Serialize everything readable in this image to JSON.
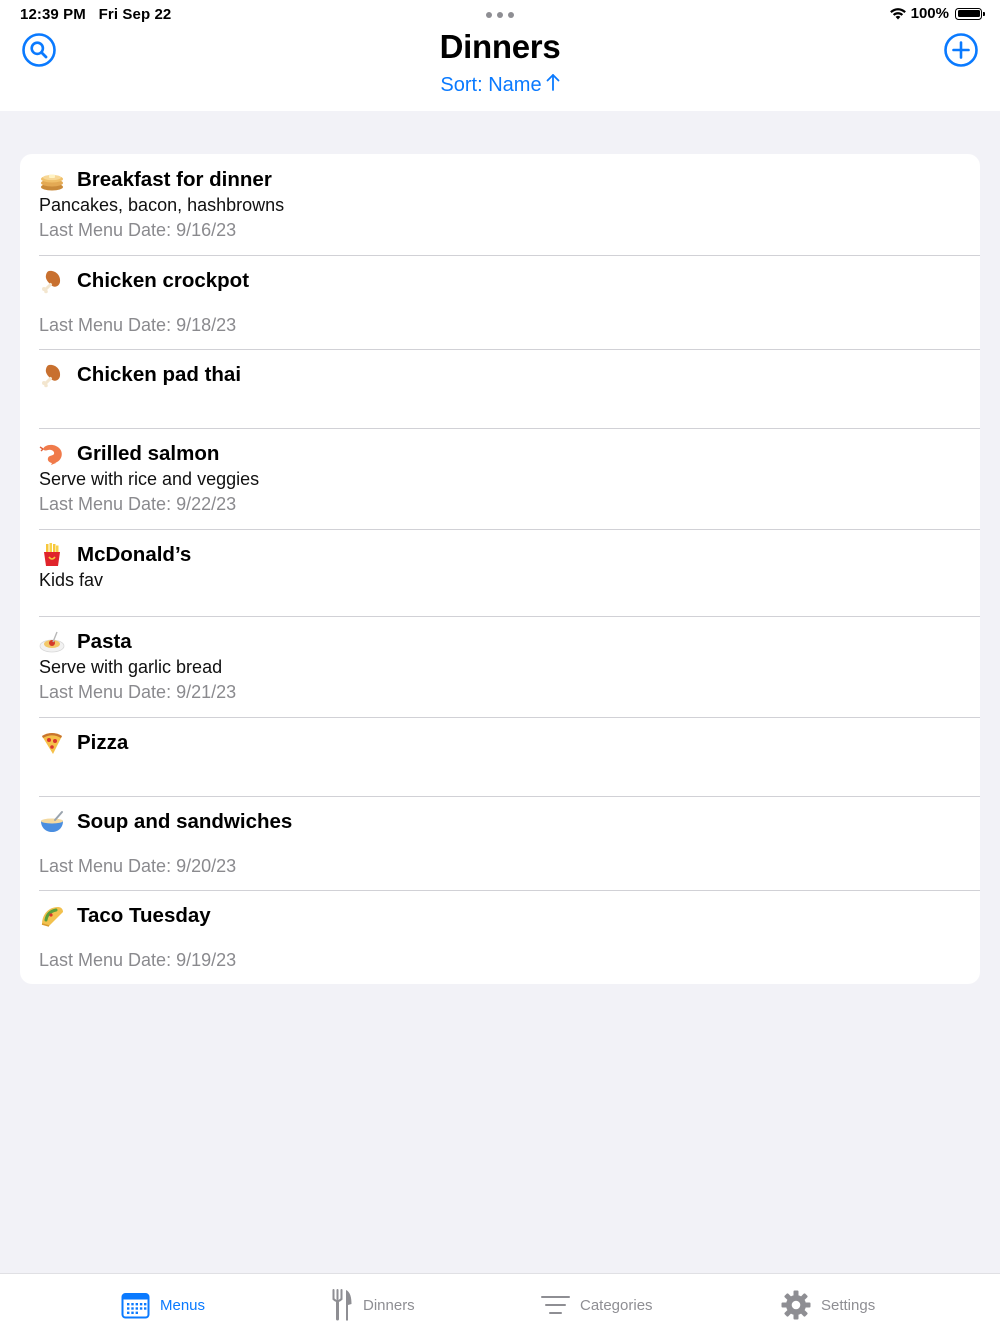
{
  "status_bar": {
    "time": "12:39 PM",
    "date": "Fri Sep 22",
    "battery": "100%"
  },
  "nav": {
    "title": "Dinners",
    "sort_label": "Sort: Name",
    "sort_direction_icon": "arrow-up-icon",
    "left_icon": "search-icon",
    "right_icon": "add-circle-icon"
  },
  "colors": {
    "accent": "#0a7aff",
    "background": "#f2f2f7",
    "secondary_text": "#8a8a8e"
  },
  "dinners": [
    {
      "emoji": "pancakes-icon",
      "name": "Breakfast for dinner",
      "description": "Pancakes, bacon, hashbrowns",
      "last_date": "Last Menu Date: 9/16/23"
    },
    {
      "emoji": "poultry-leg-icon",
      "name": "Chicken crockpot",
      "description": "",
      "last_date": "Last Menu Date: 9/18/23"
    },
    {
      "emoji": "poultry-leg-icon",
      "name": "Chicken pad thai",
      "description": "",
      "last_date": ""
    },
    {
      "emoji": "shrimp-icon",
      "name": "Grilled salmon",
      "description": "Serve with rice and veggies",
      "last_date": "Last Menu Date: 9/22/23"
    },
    {
      "emoji": "french-fries-icon",
      "name": "McDonald’s",
      "description": "Kids fav",
      "last_date": ""
    },
    {
      "emoji": "spaghetti-icon",
      "name": "Pasta",
      "description": "Serve with garlic bread",
      "last_date": "Last Menu Date: 9/21/23"
    },
    {
      "emoji": "pizza-icon",
      "name": "Pizza",
      "description": "",
      "last_date": ""
    },
    {
      "emoji": "soup-bowl-icon",
      "name": "Soup and sandwiches",
      "description": "",
      "last_date": "Last Menu Date: 9/20/23"
    },
    {
      "emoji": "taco-icon",
      "name": "Taco Tuesday",
      "description": "",
      "last_date": "Last Menu Date: 9/19/23"
    }
  ],
  "tabs": [
    {
      "label": "Menus",
      "icon": "calendar-icon",
      "active": true
    },
    {
      "label": "Dinners",
      "icon": "fork-knife-icon",
      "active": false
    },
    {
      "label": "Categories",
      "icon": "list-lines-icon",
      "active": false
    },
    {
      "label": "Settings",
      "icon": "gear-icon",
      "active": false
    }
  ]
}
